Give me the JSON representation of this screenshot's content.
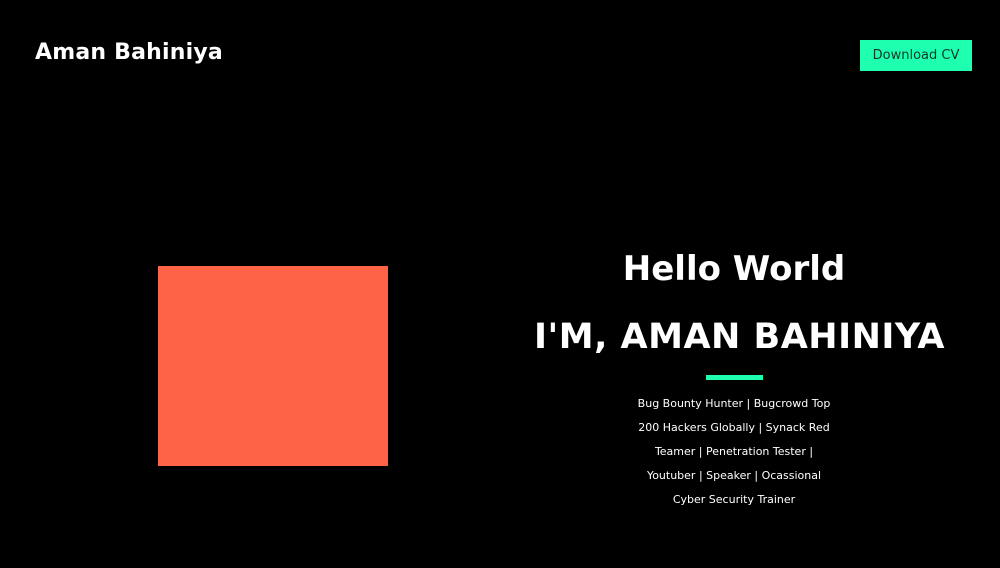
{
  "header": {
    "brand": "Aman Bahiniya",
    "cv_button": "Download CV"
  },
  "hero": {
    "greeting": "Hello World",
    "name": "I'M, AMAN BAHINIYA",
    "bio": "Bug Bounty Hunter | Bugcrowd Top 200 Hackers Globally | Synack Red Teamer | Penetration Tester | Youtuber | Speaker | Ocassional Cyber Security Trainer"
  },
  "colors": {
    "background": "#000000",
    "accent": "#1fffb0",
    "image_placeholder": "#ff6347"
  }
}
